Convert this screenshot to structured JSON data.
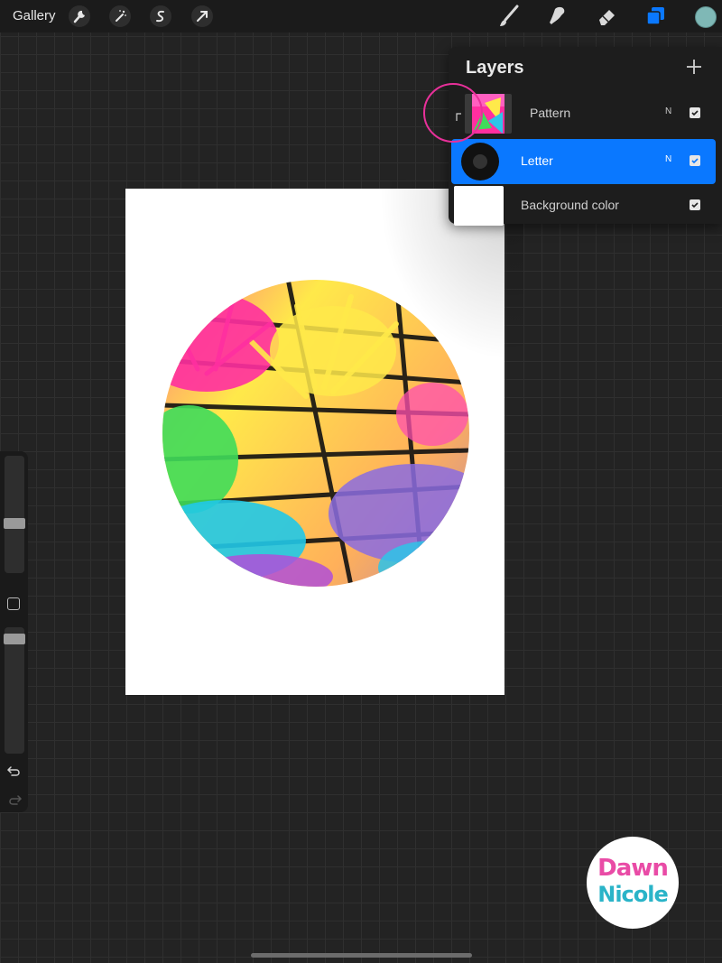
{
  "topbar": {
    "gallery_label": "Gallery",
    "left_tools": [
      "wrench-icon",
      "magic-wand-icon",
      "selection-icon",
      "transform-arrow-icon"
    ],
    "right_tools": [
      "brush-icon",
      "smudge-icon",
      "eraser-icon",
      "layers-icon"
    ],
    "current_color": "#7fb8b6"
  },
  "layers_panel": {
    "title": "Layers",
    "add_icon": "plus-icon",
    "layers": [
      {
        "name": "Pattern",
        "blend_mode": "N",
        "visible": true,
        "clipping_mask": true
      },
      {
        "name": "Letter",
        "blend_mode": "N",
        "visible": true,
        "selected": true
      },
      {
        "name": "Background color",
        "visible": true
      }
    ]
  },
  "sidebar": {
    "tools": [
      "brush-size-slider",
      "modify-button",
      "opacity-slider",
      "undo-icon",
      "redo-icon"
    ]
  },
  "logo": {
    "line1": "Dawn",
    "line2": "Nicole"
  },
  "colors": {
    "accent": "#0a78ff",
    "highlight": "#e8309a"
  }
}
